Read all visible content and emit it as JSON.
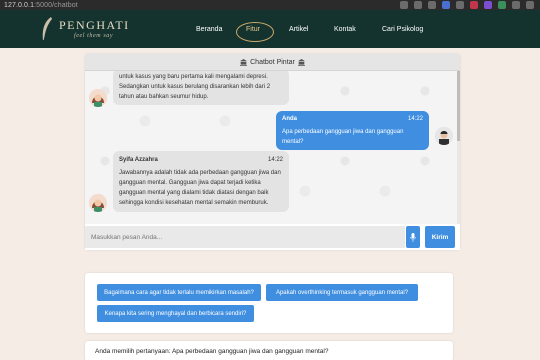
{
  "browser": {
    "url_host": "127.0.0.1",
    "url_path": ":5000/chatbot"
  },
  "site": {
    "logo_title": "PENGHATI",
    "logo_tagline": "feel them say",
    "nav": [
      {
        "label": "Beranda"
      },
      {
        "label": "Fitur"
      },
      {
        "label": "Artikel"
      },
      {
        "label": "Kontak"
      },
      {
        "label": "Cari Psikolog"
      }
    ]
  },
  "chat": {
    "header": "Chatbot Pintar",
    "messages": [
      {
        "sender": "bot",
        "text": "untuk kasus yang baru pertama kali mengalami depresi. Sedangkan untuk kasus berulang disarankan lebih dari 2 tahun atau bahkan seumur hidup."
      },
      {
        "sender": "user",
        "name": "Anda",
        "time": "14:22",
        "text": "Apa perbedaan gangguan jiwa dan gangguan mental?"
      },
      {
        "sender": "bot",
        "name": "Syifa Azzahra",
        "time": "14:22",
        "text": "Jawabannya adalah tidak ada perbedaan gangguan jiwa dan gangguan mental. Gangguan jiwa dapat terjadi ketika gangguan mental yang dialami tidak diatasi dengan baik sehingga kondisi kesehatan mental semakin memburuk."
      }
    ],
    "input_placeholder": "Masukkan pesan Anda...",
    "send_label": "Kirim"
  },
  "suggestions": [
    {
      "label": "Bagaimana cara agar tidak terlalu memikirkan masalah?"
    },
    {
      "label": "Apakah overthinking termasuk gangguan mental?"
    },
    {
      "label": "Kenapa kita sering menghayal dan berbicara sendiri?"
    }
  ],
  "selected_question": "Anda memilih pertanyaan: Apa perbedaan gangguan jiwa dan gangguan mental?",
  "colors": {
    "nav_bg": "#14332e",
    "accent_blue": "#3f8ee0",
    "page_bg": "#f6ece6"
  }
}
